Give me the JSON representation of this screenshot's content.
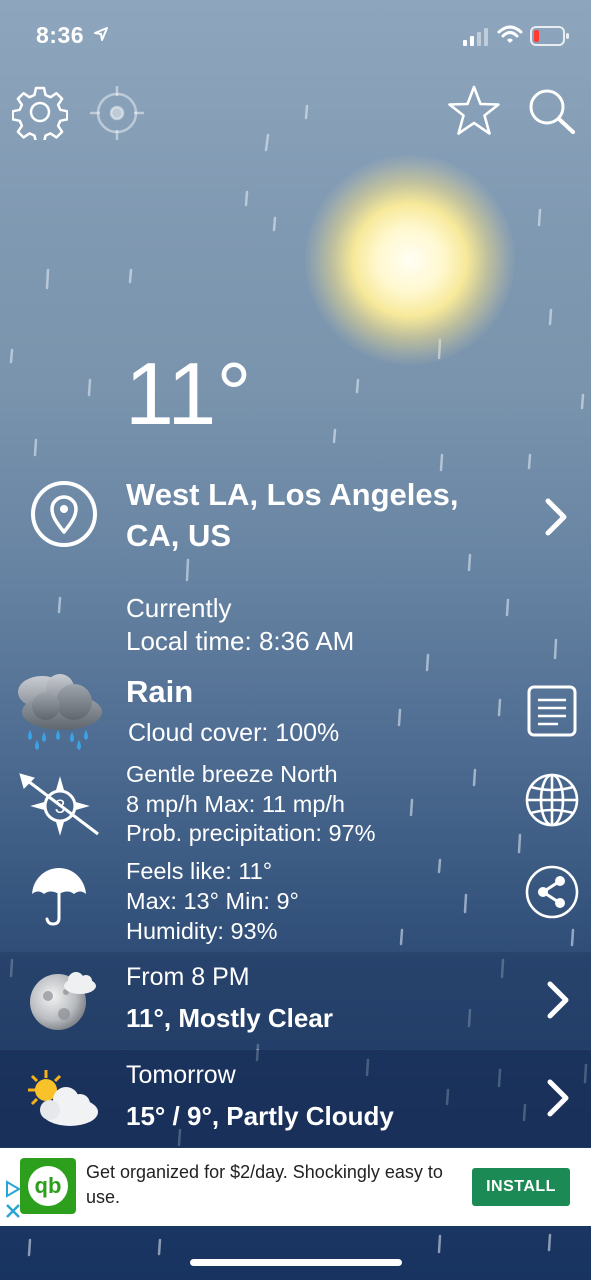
{
  "status_bar": {
    "time": "8:36"
  },
  "current": {
    "temperature": "11°",
    "location_line1": "West LA, Los Angeles,",
    "location_line2": "CA, US",
    "currently_label": "Currently",
    "local_time": "Local time: 8:36 AM",
    "condition": "Rain",
    "cloud_cover": "Cloud cover: 100%",
    "wind_line": "Gentle breeze North",
    "wind_speed": "8 mp/h Max: 11 mp/h",
    "precipitation": "Prob. precipitation: 97%",
    "wind_force": "3",
    "feels_like": "Feels like: 11°",
    "max_min": "Max: 13°  Min: 9°",
    "humidity": "Humidity: 93%"
  },
  "forecast": [
    {
      "when": "From 8 PM",
      "summary": "11°, Mostly Clear"
    },
    {
      "when": "Tomorrow",
      "summary": "15° / 9°, Partly Cloudy"
    }
  ],
  "ad": {
    "text": "Get organized for $2/day. Shockingly easy to use.",
    "install_label": "INSTALL",
    "logo_text": "qb"
  }
}
